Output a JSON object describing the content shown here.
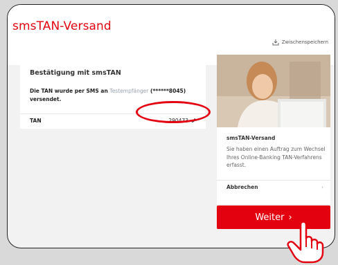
{
  "header": {
    "title": "smsTAN-Versand",
    "save_label": "Zwischenspeichern"
  },
  "confirmation": {
    "title": "Bestätigung mit smsTAN",
    "text_before": "Die TAN wurde per SMS an ",
    "masked_name": "Testempfänger",
    "text_after": " (******8045) versendet.",
    "tan_label": "TAN",
    "tan_value": "290473"
  },
  "side": {
    "title": "smsTAN-Versand",
    "text": "Sie haben einen Auftrag zum Wechsel Ihres Online-Banking TAN-Verfahrens erfasst.",
    "cancel_label": "Abbrechen",
    "chevron": "›"
  },
  "actions": {
    "next_label": "Weiter",
    "next_arrow": "›"
  },
  "colors": {
    "brand": "#e3000f",
    "background": "#f2f2f2",
    "card": "#ffffff"
  },
  "icons": [
    "save-icon",
    "pencil-icon",
    "chevron-right-icon",
    "hand-pointer-icon"
  ]
}
